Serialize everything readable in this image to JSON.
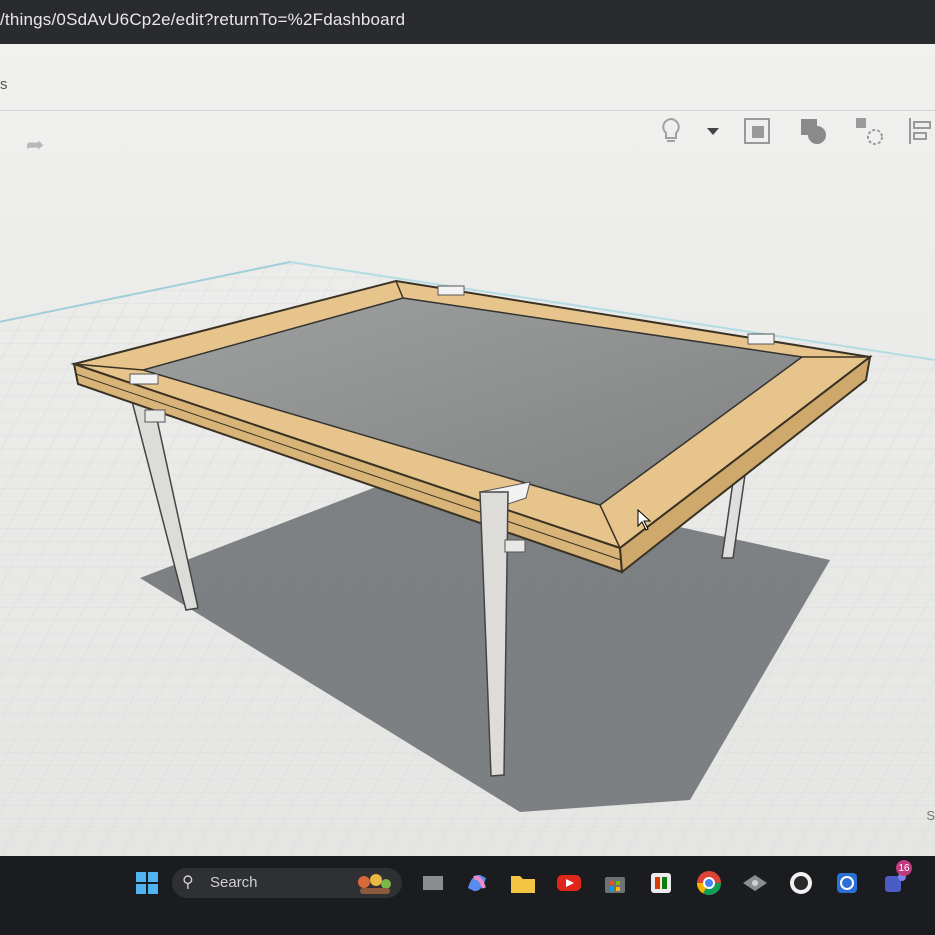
{
  "browser": {
    "url": "/things/0SdAvU6Cp2e/edit?returnTo=%2Fdashboard"
  },
  "app": {
    "menu_fragment": "s",
    "toolbar": {
      "redo_icon": "redo-arrow-icon",
      "tools": [
        "lightbulb-icon",
        "dropdown-arrow-icon",
        "copy-shape-icon",
        "group-icon",
        "shapes-icon",
        "align-icon"
      ]
    },
    "viewport_corner_text": "S",
    "model": "glass-top table with wooden frame and four metal legs"
  },
  "taskbar": {
    "search_label": "Search",
    "notification_count": "16",
    "icons": [
      "windows-start-icon",
      "search-icon",
      "widgets-icon",
      "task-view-icon",
      "copilot-icon",
      "file-explorer-icon",
      "youtube-icon",
      "store-icon",
      "office-icon",
      "chrome-icon",
      "app-icon",
      "obs-icon",
      "word-icon",
      "teams-icon"
    ]
  },
  "colors": {
    "wood": "#e6c48c",
    "glass": "#8d8f8f",
    "legs": "#d8d8d4",
    "taskbar": "#1b1c1f"
  }
}
